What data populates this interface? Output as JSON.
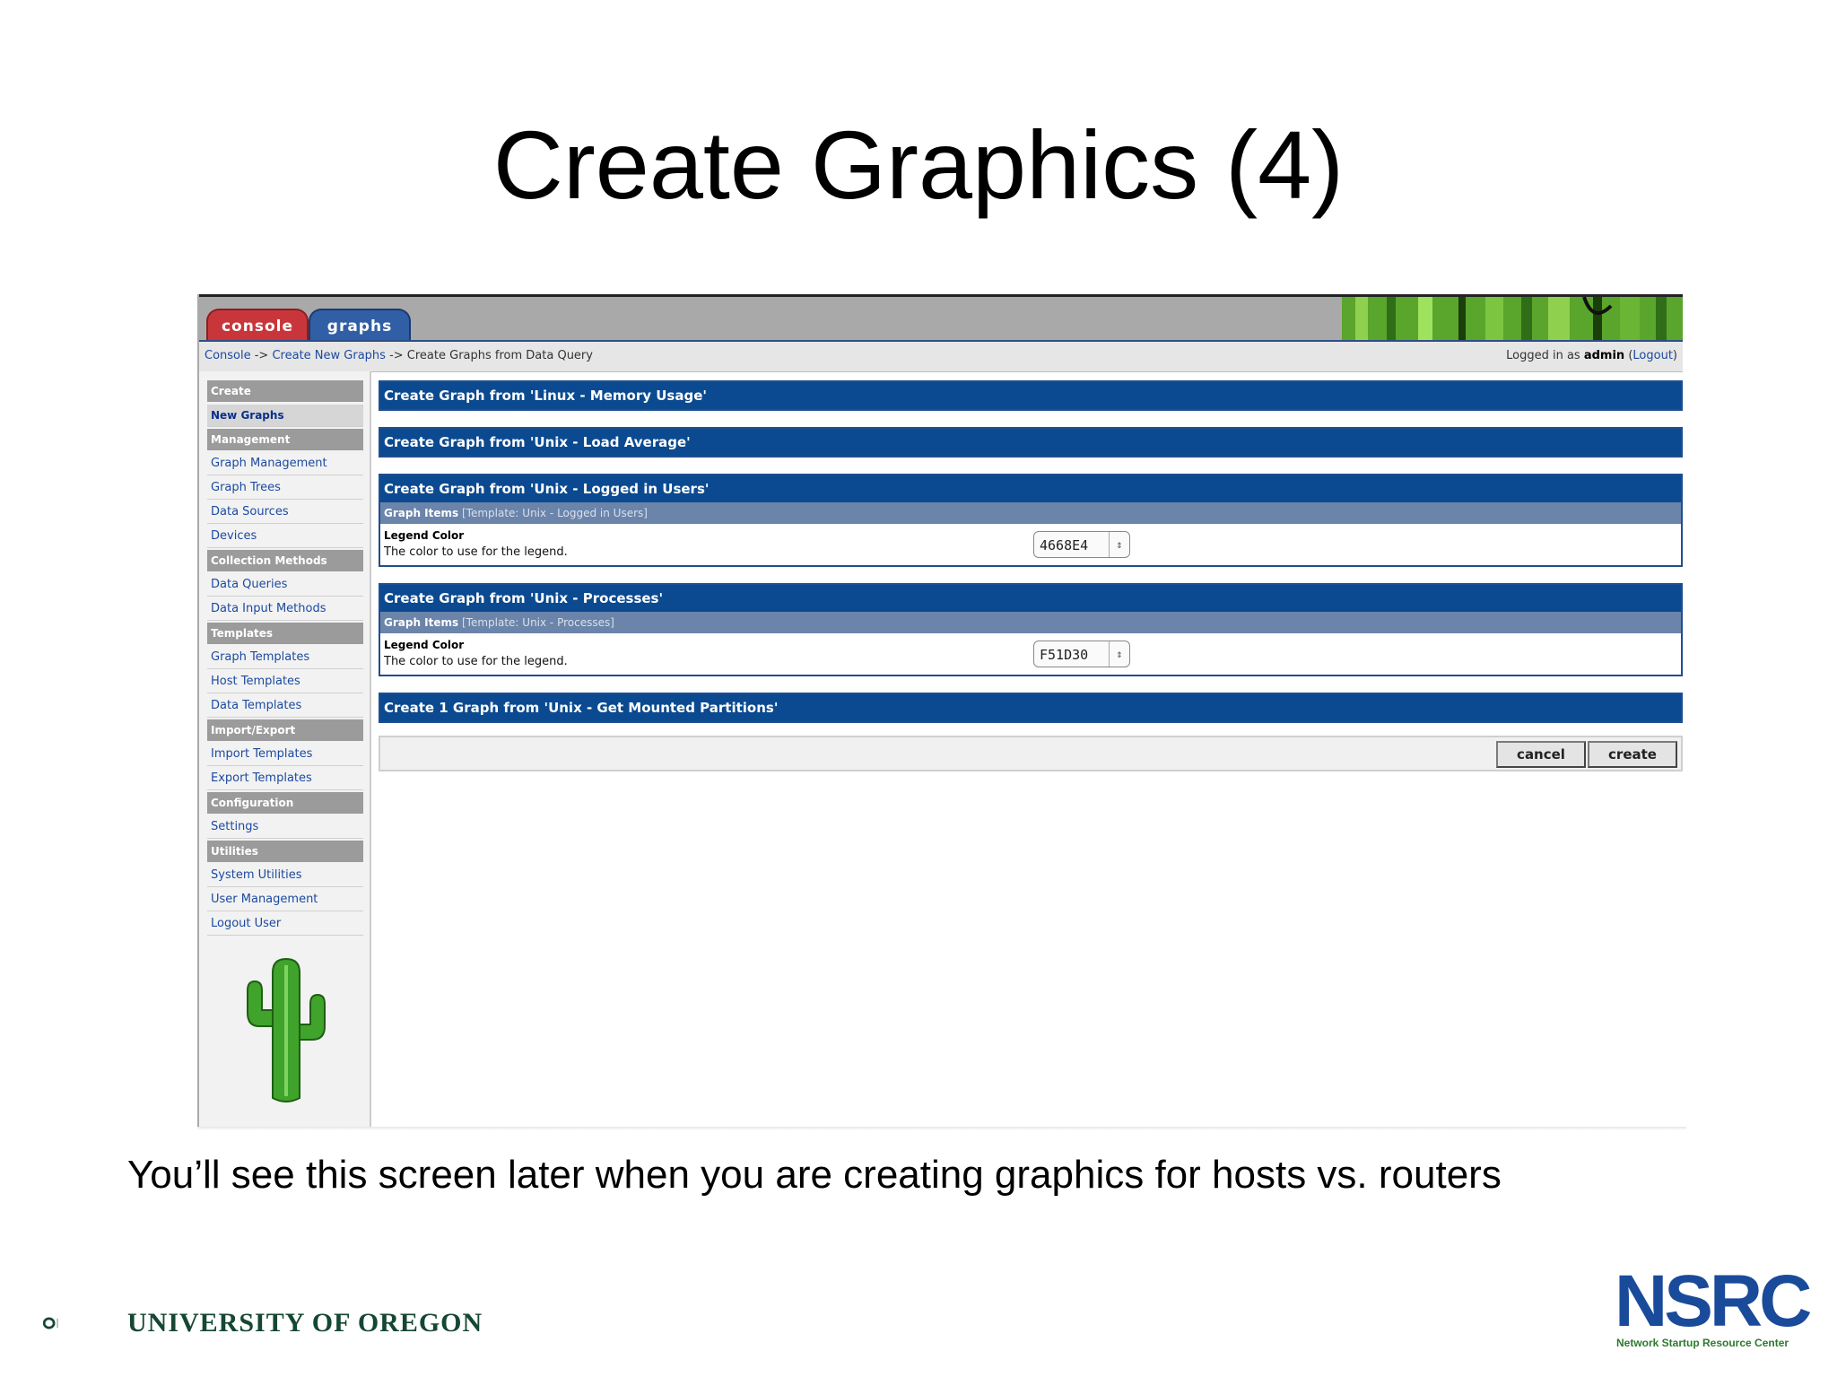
{
  "slide": {
    "title": "Create Graphics (4)",
    "caption": "You’ll see this screen later when you are creating graphics for hosts vs. routers",
    "footer_left": "UNIVERSITY OF OREGON",
    "footer_right_logo": "NSRC",
    "footer_right_sub": "Network Startup Resource Center"
  },
  "tabs": {
    "console": "console",
    "graphs": "graphs"
  },
  "breadcrumb": {
    "console": "Console",
    "sep1": " -> ",
    "new_graphs": "Create New Graphs",
    "sep2": " -> ",
    "current": "Create Graphs from Data Query"
  },
  "login": {
    "prefix": "Logged in as ",
    "user": "admin",
    "open": " (",
    "logout": "Logout",
    "close": ")"
  },
  "sidebar": {
    "sections": [
      {
        "header": "Create",
        "items": [
          {
            "label": "New Graphs",
            "selected": true
          }
        ]
      },
      {
        "header": "Management",
        "items": [
          {
            "label": "Graph Management"
          },
          {
            "label": "Graph Trees"
          },
          {
            "label": "Data Sources"
          },
          {
            "label": "Devices"
          }
        ]
      },
      {
        "header": "Collection Methods",
        "items": [
          {
            "label": "Data Queries"
          },
          {
            "label": "Data Input Methods"
          }
        ]
      },
      {
        "header": "Templates",
        "items": [
          {
            "label": "Graph Templates"
          },
          {
            "label": "Host Templates"
          },
          {
            "label": "Data Templates"
          }
        ]
      },
      {
        "header": "Import/Export",
        "items": [
          {
            "label": "Import Templates"
          },
          {
            "label": "Export Templates"
          }
        ]
      },
      {
        "header": "Configuration",
        "items": [
          {
            "label": "Settings"
          }
        ]
      },
      {
        "header": "Utilities",
        "items": [
          {
            "label": "System Utilities"
          },
          {
            "label": "User Management"
          },
          {
            "label": "Logout User"
          }
        ]
      }
    ]
  },
  "main": {
    "boxes": [
      {
        "header": "Create Graph from 'Linux - Memory Usage'"
      },
      {
        "header": "Create Graph from 'Unix - Load Average'"
      },
      {
        "header": "Create Graph from 'Unix - Logged in Users'",
        "sub_bold": "Graph Items",
        "sub_rest": " [Template: Unix - Logged in Users]",
        "field_title": "Legend Color",
        "field_desc": "The color to use for the legend.",
        "color_value": "4668E4"
      },
      {
        "header": "Create Graph from 'Unix - Processes'",
        "sub_bold": "Graph Items",
        "sub_rest": " [Template: Unix - Processes]",
        "field_title": "Legend Color",
        "field_desc": "The color to use for the legend.",
        "color_value": "F51D30"
      },
      {
        "header": "Create 1 Graph from 'Unix - Get Mounted Partitions'"
      }
    ],
    "cancel_label": "cancel",
    "create_label": "create"
  },
  "colors": {
    "header_blue": "#0b4a90",
    "tab_console": "#c8363b",
    "tab_graphs": "#315fa6",
    "link_blue": "#1c4aa0",
    "uo_green": "#154733",
    "nsrc_blue": "#1a4a9a"
  },
  "icons": {
    "select_arrow": "updown-arrow-icon",
    "banner": "cactus-banner-image",
    "sidebar_logo": "cactus-logo",
    "uo_logo": "oregon-o-logo"
  }
}
